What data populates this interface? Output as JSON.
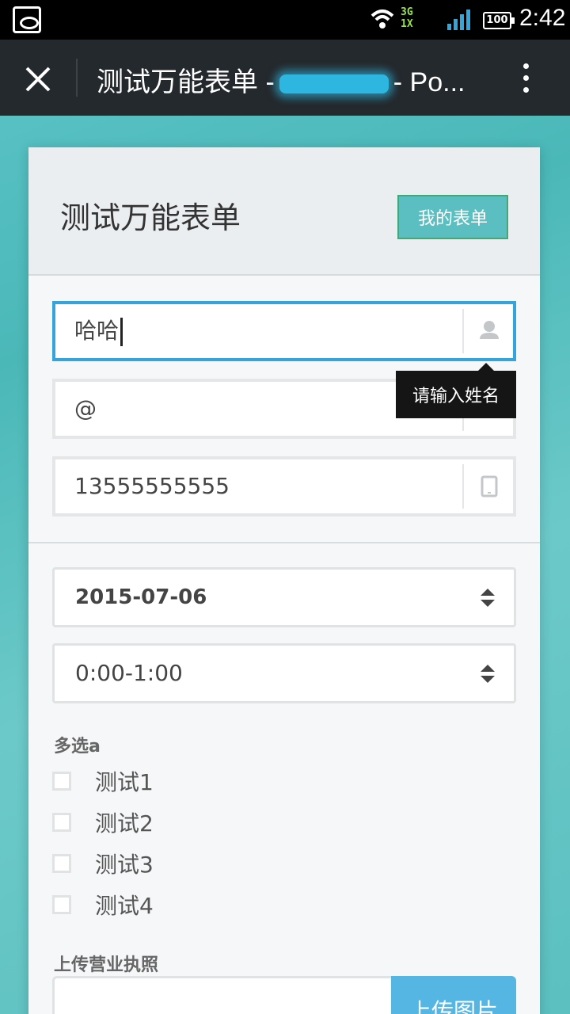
{
  "statusbar": {
    "network_top": "3G",
    "network_bottom": "1X",
    "battery": "100",
    "time": "2:42"
  },
  "titlebar": {
    "title_prefix": "测试万能表单 -",
    "title_suffix": "- Po..."
  },
  "form": {
    "title": "测试万能表单",
    "my_forms_button": "我的表单",
    "name_value": "哈哈",
    "name_tooltip": "请输入姓名",
    "email_value": "@",
    "phone_value": "13555555555",
    "date_value": "2015-07-06",
    "time_value": "0:00-1:00",
    "multi_label": "多选a",
    "options": [
      "测试1",
      "测试2",
      "测试3",
      "测试4"
    ],
    "upload_label": "上传营业执照",
    "upload_button": "上传图片"
  },
  "colors": {
    "accent": "#34a5dc",
    "button_teal": "#5bbfc1",
    "upload_blue": "#56b6e3",
    "titlebar": "#24292d"
  },
  "icons": {
    "close": "close-icon",
    "more": "more-vert-icon",
    "user": "user-icon",
    "mail": "mail-icon",
    "tablet": "tablet-icon"
  }
}
